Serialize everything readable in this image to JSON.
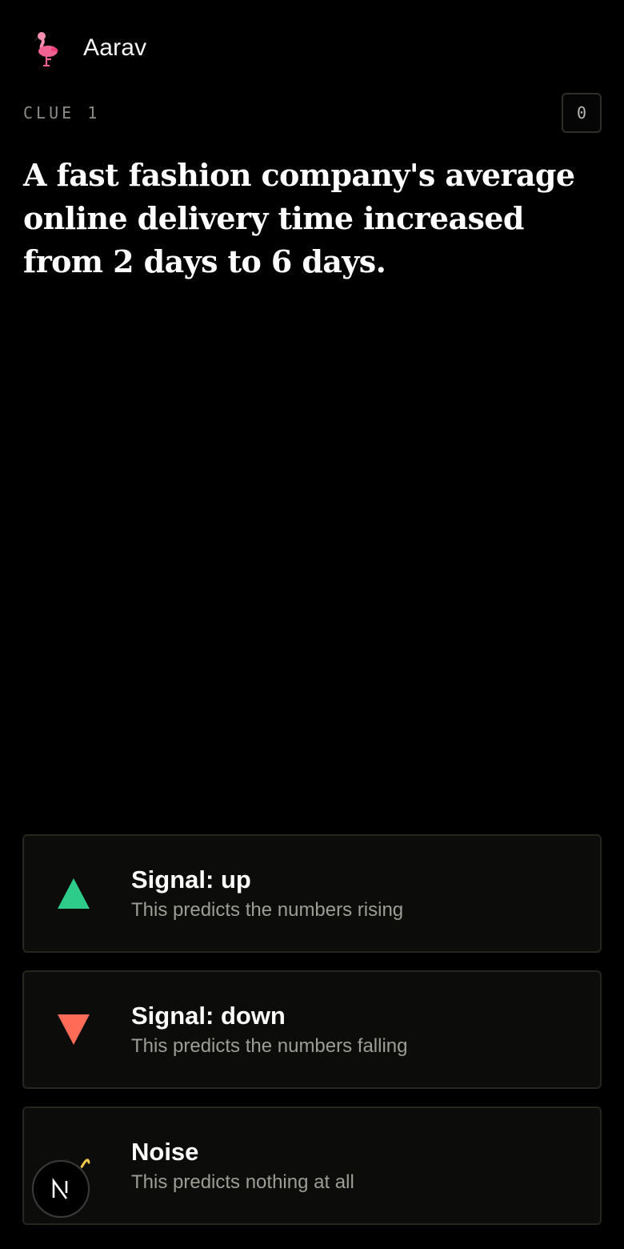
{
  "header": {
    "avatar_icon": "flamingo-icon",
    "username": "Aarav"
  },
  "clue": {
    "label": "CLUE 1",
    "score": "0",
    "text": "A fast fashion company's average online delivery time increased from 2 days to 6 days."
  },
  "options": [
    {
      "icon": "triangle-up-icon",
      "icon_color": "#2ecc8a",
      "title": "Signal: up",
      "description": "This predicts the numbers rising"
    },
    {
      "icon": "triangle-down-icon",
      "icon_color": "#ff6b57",
      "title": "Signal: down",
      "description": "This predicts the numbers falling"
    },
    {
      "icon": "noise-icon",
      "title": "Noise",
      "description": "This predicts nothing at all"
    }
  ],
  "floating_badge": {
    "icon": "nextjs-n-icon",
    "label": "N"
  },
  "colors": {
    "background": "#000000",
    "card_background": "#0c0c0a",
    "card_border": "#26261f",
    "muted_text": "#9d9d96",
    "up": "#2ecc8a",
    "down": "#ff6b57"
  }
}
